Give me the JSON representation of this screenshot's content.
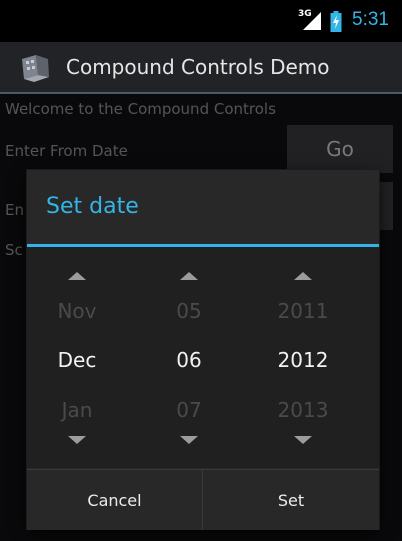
{
  "status_bar": {
    "network": "3G",
    "time": "5:31"
  },
  "action_bar": {
    "title": "Compound Controls Demo",
    "icon": "app-icon"
  },
  "background": {
    "welcome_text": "Welcome to the Compound Controls",
    "from_label": "Enter From Date",
    "to_label_partial": "En",
    "third_label_partial": "Sc",
    "go_label": "Go"
  },
  "dialog": {
    "title": "Set date",
    "columns": [
      {
        "name": "month",
        "prev": "Nov",
        "current": "Dec",
        "next": "Jan"
      },
      {
        "name": "day",
        "prev": "05",
        "current": "06",
        "next": "07"
      },
      {
        "name": "year",
        "prev": "2011",
        "current": "2012",
        "next": "2013"
      }
    ],
    "cancel_label": "Cancel",
    "set_label": "Set"
  },
  "colors": {
    "accent": "#33b5e5",
    "dialog_bg": "#282829",
    "picker_bg": "#202021",
    "screen_bg": "#111214"
  }
}
